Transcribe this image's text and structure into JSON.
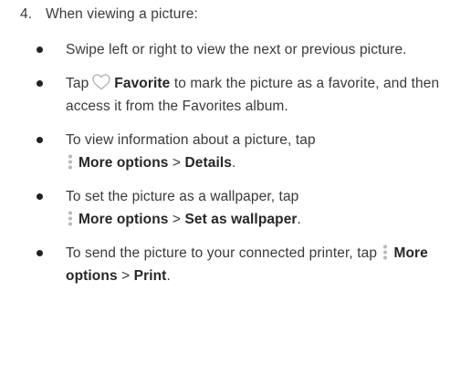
{
  "step": {
    "number": "4.",
    "text": "When viewing a picture:"
  },
  "bullets": [
    {
      "text": "Swipe left or right to view the next or previous picture."
    },
    {
      "pre": "Tap",
      "icon": "heart-outline-icon",
      "bold": "Favorite",
      "post": " to mark the picture as a favorite, and then access it from the Favorites album."
    },
    {
      "pre": "To view information about a picture, tap ",
      "icon": "more-options-icon",
      "bold1": "More options",
      "sep": " > ",
      "bold2": "Details",
      "end": "."
    },
    {
      "pre": "To set the picture as a wallpaper, tap ",
      "icon": "more-options-icon",
      "bold1": "More options",
      "sep": " > ",
      "bold2": "Set as wallpaper",
      "end": "."
    },
    {
      "pre": "To send the picture to your connected printer, tap ",
      "icon": "more-options-icon",
      "bold1": "More options",
      "sep": " > ",
      "bold2": "Print",
      "end": "."
    }
  ],
  "colors": {
    "text": "#3a3a3a",
    "bold": "#262626",
    "icon": "#b8b8b8"
  }
}
